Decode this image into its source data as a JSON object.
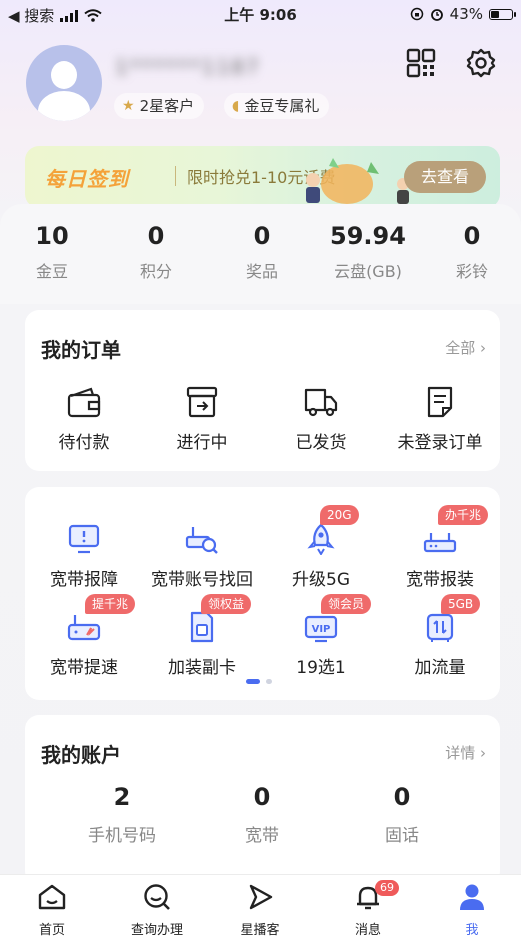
{
  "status_bar": {
    "back_label": "◀ 搜索",
    "time": "上午 9:06",
    "battery": "43%",
    "battery_level": 0.43
  },
  "profile": {
    "username": "1******1187",
    "tags": [
      {
        "label": "2星客户",
        "icon": "star-icon"
      },
      {
        "label": "金豆专属礼",
        "icon": "bean-icon"
      }
    ],
    "icons": [
      "qr-code-icon",
      "gear-icon"
    ]
  },
  "banner": {
    "title": "每日签到",
    "subtitle": "限时抢兑1-10元话费",
    "button": "去查看"
  },
  "stats": [
    {
      "value": "10",
      "label": "金豆"
    },
    {
      "value": "0",
      "label": "积分"
    },
    {
      "value": "0",
      "label": "奖品"
    },
    {
      "value": "59.94",
      "label": "云盘(GB)"
    },
    {
      "value": "0",
      "label": "彩铃"
    }
  ],
  "orders": {
    "title": "我的订单",
    "more": "全部",
    "items": [
      {
        "label": "待付款",
        "icon": "wallet-icon"
      },
      {
        "label": "进行中",
        "icon": "box-icon"
      },
      {
        "label": "已发货",
        "icon": "truck-icon"
      },
      {
        "label": "未登录订单",
        "icon": "document-icon"
      }
    ]
  },
  "services": {
    "items": [
      {
        "label": "宽带报障",
        "icon": "monitor-alert-icon",
        "badge": ""
      },
      {
        "label": "宽带账号找回",
        "icon": "router-search-icon",
        "badge": ""
      },
      {
        "label": "升级5G",
        "icon": "rocket-icon",
        "badge": "20G"
      },
      {
        "label": "宽带报装",
        "icon": "router-icon",
        "badge": "办千兆"
      },
      {
        "label": "宽带提速",
        "icon": "speed-router-icon",
        "badge": "提千兆"
      },
      {
        "label": "加装副卡",
        "icon": "sim-card-icon",
        "badge": "领权益"
      },
      {
        "label": "19选1",
        "icon": "vip-tv-icon",
        "badge": "领会员"
      },
      {
        "label": "加流量",
        "icon": "data-flow-icon",
        "badge": "5GB"
      }
    ],
    "page": 1,
    "pages": 2
  },
  "account": {
    "title": "我的账户",
    "more": "详情",
    "items": [
      {
        "value": "2",
        "label": "手机号码"
      },
      {
        "value": "0",
        "label": "宽带"
      },
      {
        "value": "0",
        "label": "固话"
      }
    ]
  },
  "tabbar": {
    "items": [
      {
        "label": "首页",
        "icon": "home-icon"
      },
      {
        "label": "查询办理",
        "icon": "search-icon"
      },
      {
        "label": "星播客",
        "icon": "play-icon"
      },
      {
        "label": "消息",
        "icon": "bell-icon",
        "badge": "69"
      },
      {
        "label": "我",
        "icon": "user-icon"
      }
    ],
    "active": 4
  },
  "colors": {
    "accent": "#4a6cf0",
    "badge": "#ef6a6a",
    "banner_text": "#f4a23a"
  }
}
